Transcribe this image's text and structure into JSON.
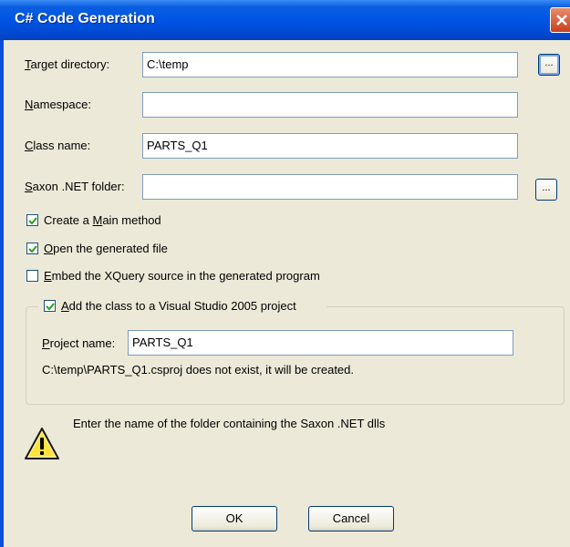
{
  "window": {
    "title": "C# Code Generation"
  },
  "fields": {
    "target_directory": {
      "label": "Target directory:",
      "mnemonic": "T",
      "rest": "arget directory:",
      "value": "C:\\temp",
      "browse": "..."
    },
    "namespace": {
      "label": "Namespace:",
      "mnemonic": "N",
      "rest": "amespace:",
      "value": ""
    },
    "class_name": {
      "label": "Class name:",
      "mnemonic": "C",
      "rest": "lass name:",
      "value": "PARTS_Q1"
    },
    "saxon_folder": {
      "label": "Saxon .NET folder:",
      "mnemonic": "S",
      "rest": "axon .NET folder:",
      "value": "",
      "browse": "..."
    }
  },
  "options": {
    "main_method": {
      "pre": "Create a ",
      "mnemonic": "M",
      "post": "ain method",
      "checked": true
    },
    "open_file": {
      "pre": "",
      "mnemonic": "O",
      "post": "pen the generated file",
      "checked": true
    },
    "embed_xquery": {
      "pre": "",
      "mnemonic": "E",
      "post": "mbed the XQuery source in the generated program",
      "checked": false
    }
  },
  "project_group": {
    "checkbox": {
      "pre": "",
      "mnemonic": "A",
      "post": "dd the class to a Visual Studio 2005 project",
      "checked": true
    },
    "project_name": {
      "mnemonic": "P",
      "rest": "roject name:",
      "value": "PARTS_Q1"
    },
    "status": "C:\\temp\\PARTS_Q1.csproj does not exist, it will be created."
  },
  "hint": {
    "text": "Enter the name of the folder containing the Saxon .NET dlls",
    "icon": "warning-icon"
  },
  "buttons": {
    "ok": "OK",
    "cancel": "Cancel"
  }
}
